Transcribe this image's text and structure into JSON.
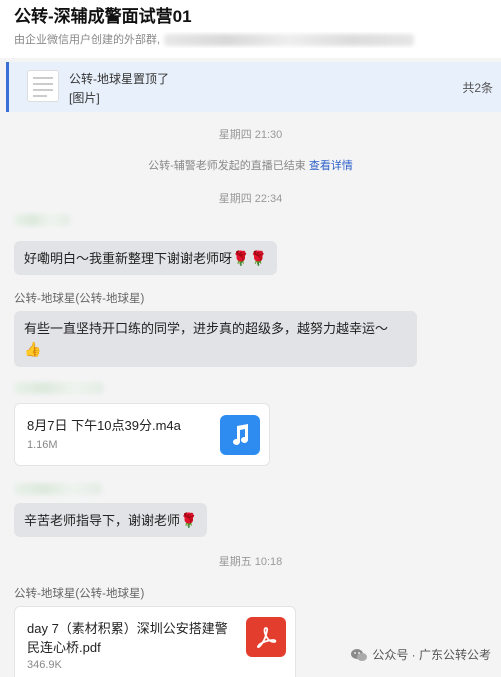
{
  "header": {
    "title": "公转-深辅成警面试营01",
    "subtitle": "由企业微信用户创建的外部群,"
  },
  "pinned": {
    "title": "公转-地球星置顶了",
    "content": "[图片]",
    "count": "共2条"
  },
  "timestamps": {
    "t1": "星期四 21:30",
    "t2": "星期四 22:34",
    "t3": "星期五 10:18"
  },
  "system": {
    "text": "公转-辅警老师发起的直播已结束",
    "link": "查看详情"
  },
  "messages": {
    "m1": {
      "text": "好嘞明白～我重新整理下谢谢老师呀",
      "emoji": "🌹🌹"
    },
    "m2": {
      "sender": "公转-地球星(公转-地球星)",
      "text": "有些一直坚持开口练的同学，进步真的超级多，越努力越幸运～",
      "emoji": "👍"
    },
    "m3": {
      "file_name": "8月7日 下午10点39分.m4a",
      "file_size": "1.16M"
    },
    "m4": {
      "text": "辛苦老师指导下，谢谢老师",
      "emoji": "🌹"
    },
    "m5": {
      "sender": "公转-地球星(公转-地球星)",
      "file_name_1": "day 7（素材积累）深圳公安搭建警",
      "file_name_2": "民连心桥.pdf",
      "file_size": "346.9K"
    }
  },
  "watermark": {
    "text": "公众号 · 广东公转公考"
  },
  "icons": {
    "audio": "music-note-icon",
    "pdf": "pdf-icon",
    "watermark": "wechat-icon"
  },
  "colors": {
    "link": "#2e62c9",
    "pinned_bg": "#e8f0fb",
    "audio_icon": "#2e8cf0",
    "pdf_icon": "#e33d2e"
  }
}
